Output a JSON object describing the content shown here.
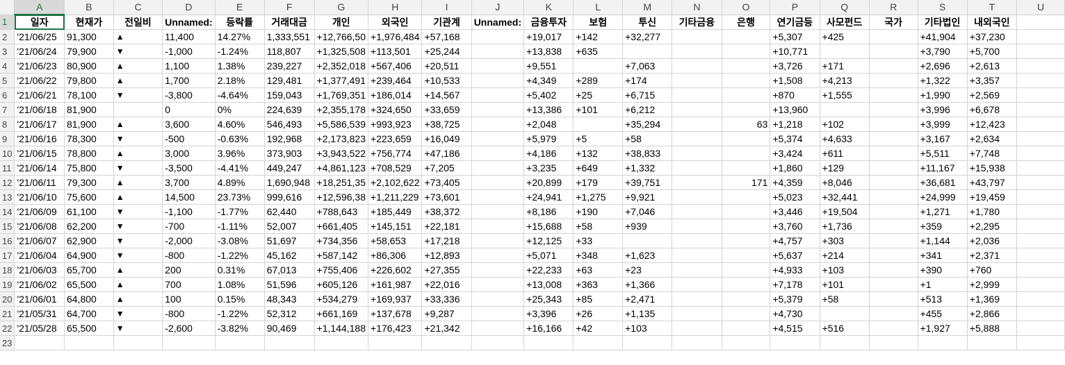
{
  "columns": [
    "A",
    "B",
    "C",
    "D",
    "E",
    "F",
    "G",
    "H",
    "I",
    "J",
    "K",
    "L",
    "M",
    "N",
    "O",
    "P",
    "Q",
    "R",
    "S",
    "T",
    "U"
  ],
  "headers": [
    "일자",
    "현재가",
    "전일비",
    "Unnamed:",
    "등락률",
    "거래대금",
    "개인",
    "외국인",
    "기관계",
    "Unnamed:",
    "금융투자",
    "보험",
    "투신",
    "기타금융",
    "은행",
    "연기금등",
    "사모펀드",
    "국가",
    "기타법인",
    "내외국인",
    ""
  ],
  "rows": [
    [
      "'21/06/25",
      "91,300",
      "▲",
      "11,400",
      "14.27%",
      "1,333,551",
      "+12,766,50",
      "+1,976,484",
      "+57,168",
      "",
      "+19,017",
      "+142",
      "+32,277",
      "",
      "",
      "+5,307",
      "+425",
      "",
      "+41,904",
      "+37,230",
      ""
    ],
    [
      "'21/06/24",
      "79,900",
      "▼",
      "-1,000",
      "-1.24%",
      "118,807",
      "+1,325,508",
      "+113,501",
      "+25,244",
      "",
      "+13,838",
      "+635",
      "",
      "",
      "",
      "+10,771",
      "",
      "",
      "+3,790",
      "+5,700",
      ""
    ],
    [
      "'21/06/23",
      "80,900",
      "▲",
      "1,100",
      "1.38%",
      "239,227",
      "+2,352,018",
      "+567,406",
      "+20,511",
      "",
      "+9,551",
      "",
      "+7,063",
      "",
      "",
      "+3,726",
      "+171",
      "",
      "+2,696",
      "+2,613",
      ""
    ],
    [
      "'21/06/22",
      "79,800",
      "▲",
      "1,700",
      "2.18%",
      "129,481",
      "+1,377,491",
      "+239,464",
      "+10,533",
      "",
      "+4,349",
      "+289",
      "+174",
      "",
      "",
      "+1,508",
      "+4,213",
      "",
      "+1,322",
      "+3,357",
      ""
    ],
    [
      "'21/06/21",
      "78,100",
      "▼",
      "-3,800",
      "-4.64%",
      "159,043",
      "+1,769,351",
      "+186,014",
      "+14,567",
      "",
      "+5,402",
      "+25",
      "+6,715",
      "",
      "",
      "+870",
      "+1,555",
      "",
      "+1,990",
      "+2,569",
      ""
    ],
    [
      "'21/06/18",
      "81,900",
      "",
      "0",
      "0%",
      "224,639",
      "+2,355,178",
      "+324,650",
      "+33,659",
      "",
      "+13,386",
      "+101",
      "+6,212",
      "",
      "",
      "+13,960",
      "",
      "",
      "+3,996",
      "+6,678",
      ""
    ],
    [
      "'21/06/17",
      "81,900",
      "▲",
      "3,600",
      "4.60%",
      "546,493",
      "+5,586,539",
      "+993,923",
      "+38,725",
      "",
      "+2,048",
      "",
      "+35,294",
      "",
      "63",
      "+1,218",
      "+102",
      "",
      "+3,999",
      "+12,423",
      ""
    ],
    [
      "'21/06/16",
      "78,300",
      "▼",
      "-500",
      "-0.63%",
      "192,968",
      "+2,173,823",
      "+223,659",
      "+16,049",
      "",
      "+5,979",
      "+5",
      "+58",
      "",
      "",
      "+5,374",
      "+4,633",
      "",
      "+3,167",
      "+2,634",
      ""
    ],
    [
      "'21/06/15",
      "78,800",
      "▲",
      "3,000",
      "3.96%",
      "373,903",
      "+3,943,522",
      "+756,774",
      "+47,186",
      "",
      "+4,186",
      "+132",
      "+38,833",
      "",
      "",
      "+3,424",
      "+611",
      "",
      "+5,511",
      "+7,748",
      ""
    ],
    [
      "'21/06/14",
      "75,800",
      "▼",
      "-3,500",
      "-4.41%",
      "449,247",
      "+4,861,123",
      "+708,529",
      "+7,205",
      "",
      "+3,235",
      "+649",
      "+1,332",
      "",
      "",
      "+1,860",
      "+129",
      "",
      "+11,167",
      "+15,938",
      ""
    ],
    [
      "'21/06/11",
      "79,300",
      "▲",
      "3,700",
      "4.89%",
      "1,690,948",
      "+18,251,35",
      "+2,102,622",
      "+73,405",
      "",
      "+20,899",
      "+179",
      "+39,751",
      "",
      "171",
      "+4,359",
      "+8,046",
      "",
      "+36,681",
      "+43,797",
      ""
    ],
    [
      "'21/06/10",
      "75,600",
      "▲",
      "14,500",
      "23.73%",
      "999,616",
      "+12,596,38",
      "+1,211,229",
      "+73,601",
      "",
      "+24,941",
      "+1,275",
      "+9,921",
      "",
      "",
      "+5,023",
      "+32,441",
      "",
      "+24,999",
      "+19,459",
      ""
    ],
    [
      "'21/06/09",
      "61,100",
      "▼",
      "-1,100",
      "-1.77%",
      "62,440",
      "+788,643",
      "+185,449",
      "+38,372",
      "",
      "+8,186",
      "+190",
      "+7,046",
      "",
      "",
      "+3,446",
      "+19,504",
      "",
      "+1,271",
      "+1,780",
      ""
    ],
    [
      "'21/06/08",
      "62,200",
      "▼",
      "-700",
      "-1.11%",
      "52,007",
      "+661,405",
      "+145,151",
      "+22,181",
      "",
      "+15,688",
      "+58",
      "+939",
      "",
      "",
      "+3,760",
      "+1,736",
      "",
      "+359",
      "+2,295",
      ""
    ],
    [
      "'21/06/07",
      "62,900",
      "▼",
      "-2,000",
      "-3.08%",
      "51,697",
      "+734,356",
      "+58,653",
      "+17,218",
      "",
      "+12,125",
      "+33",
      "",
      "",
      "",
      "+4,757",
      "+303",
      "",
      "+1,144",
      "+2,036",
      ""
    ],
    [
      "'21/06/04",
      "64,900",
      "▼",
      "-800",
      "-1.22%",
      "45,162",
      "+587,142",
      "+86,306",
      "+12,893",
      "",
      "+5,071",
      "+348",
      "+1,623",
      "",
      "",
      "+5,637",
      "+214",
      "",
      "+341",
      "+2,371",
      ""
    ],
    [
      "'21/06/03",
      "65,700",
      "▲",
      "200",
      "0.31%",
      "67,013",
      "+755,406",
      "+226,602",
      "+27,355",
      "",
      "+22,233",
      "+63",
      "+23",
      "",
      "",
      "+4,933",
      "+103",
      "",
      "+390",
      "+760",
      ""
    ],
    [
      "'21/06/02",
      "65,500",
      "▲",
      "700",
      "1.08%",
      "51,596",
      "+605,126",
      "+161,987",
      "+22,016",
      "",
      "+13,008",
      "+363",
      "+1,366",
      "",
      "",
      "+7,178",
      "+101",
      "",
      "+1",
      "+2,999",
      ""
    ],
    [
      "'21/06/01",
      "64,800",
      "▲",
      "100",
      "0.15%",
      "48,343",
      "+534,279",
      "+169,937",
      "+33,336",
      "",
      "+25,343",
      "+85",
      "+2,471",
      "",
      "",
      "+5,379",
      "+58",
      "",
      "+513",
      "+1,369",
      ""
    ],
    [
      "'21/05/31",
      "64,700",
      "▼",
      "-800",
      "-1.22%",
      "52,312",
      "+661,169",
      "+137,678",
      "+9,287",
      "",
      "+3,396",
      "+26",
      "+1,135",
      "",
      "",
      "+4,730",
      "",
      "",
      "+455",
      "+2,866",
      ""
    ],
    [
      "'21/05/28",
      "65,500",
      "▼",
      "-2,600",
      "-3.82%",
      "90,469",
      "+1,144,188",
      "+176,423",
      "+21,342",
      "",
      "+16,166",
      "+42",
      "+103",
      "",
      "",
      "+4,515",
      "+516",
      "",
      "+1,927",
      "+5,888",
      ""
    ]
  ]
}
